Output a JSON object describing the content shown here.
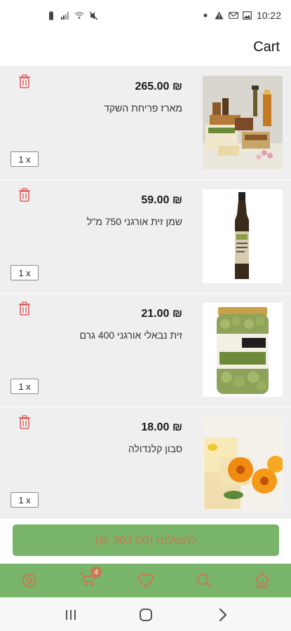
{
  "status_bar": {
    "time": "10:22"
  },
  "header": {
    "title": "Cart"
  },
  "cart": {
    "items": [
      {
        "price": "265.00 ₪",
        "name": "מארז פריחת השקד",
        "quantity": "1 x",
        "image_icon": "gift-basket-image"
      },
      {
        "price": "59.00 ₪",
        "name": "שמן זית אורגני 750 מ\"ל",
        "quantity": "1 x",
        "image_icon": "olive-oil-bottle-image"
      },
      {
        "price": "21.00 ₪",
        "name": "זית נבאלי אורגני 400 גרם",
        "quantity": "1 x",
        "image_icon": "olive-jar-image"
      },
      {
        "price": "18.00 ₪",
        "name": "סבון קלנדולה",
        "quantity": "1 x",
        "image_icon": "calendula-soap-image"
      }
    ]
  },
  "checkout": {
    "label": "לתשלום (363.00 ₪)"
  },
  "bottom_nav": {
    "cart_badge": "4",
    "items": [
      "settings-icon",
      "cart-icon",
      "heart-icon",
      "search-icon",
      "home-icon"
    ]
  },
  "colors": {
    "accent_green": "#79b46b",
    "accent_orange": "#c67a52",
    "trash_red": "#e05a5a"
  }
}
